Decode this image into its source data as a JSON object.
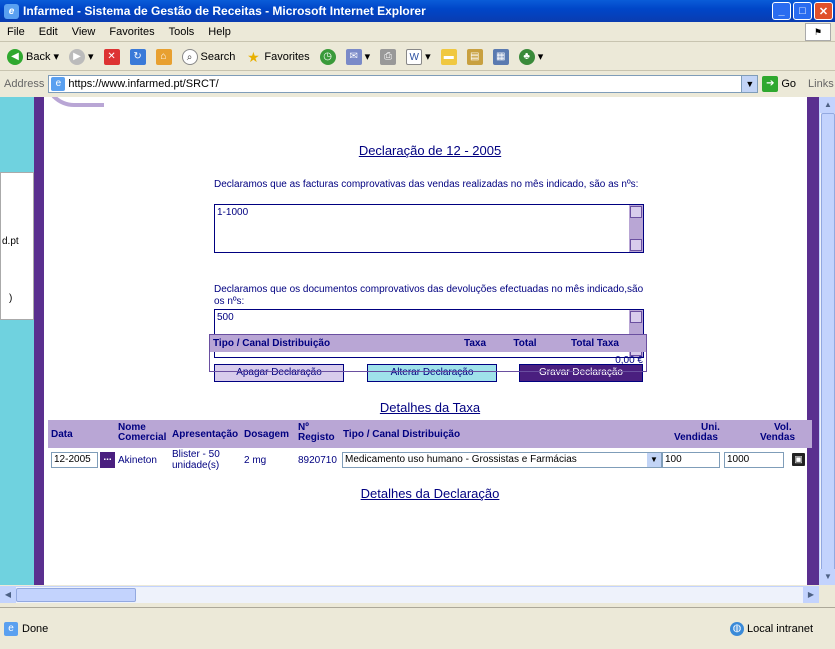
{
  "window": {
    "title": "Infarmed - Sistema de Gestão de Receitas - Microsoft Internet Explorer"
  },
  "menu": [
    "File",
    "Edit",
    "View",
    "Favorites",
    "Tools",
    "Help"
  ],
  "toolbar": {
    "back": "Back",
    "search": "Search",
    "favorites": "Favorites"
  },
  "address": {
    "label": "Address",
    "url": "https://www.infarmed.pt/SRCT/",
    "go": "Go",
    "links": "Links"
  },
  "left": {
    "fragment1": "d.pt",
    "fragment2": ")"
  },
  "page": {
    "title": "Declaração de 12 - 2005",
    "facturas_text": "Declaramos que as facturas comprovativas das vendas realizadas no mês indicado, são as nºs:",
    "facturas_value": "1-1000",
    "devolucoes_text": "Declaramos que os documentos comprovativos das devoluções efectuadas no mês indicado,são os nºs:",
    "devolucoes_value": "500",
    "btn_apagar": "Apagar Declaração",
    "btn_alterar": "Alterar Declaração",
    "btn_gravar": "Gravar Declaração",
    "taxa_heading": "Detalhes da Taxa",
    "taxa_cols": {
      "tipo": "Tipo / Canal Distribuição",
      "taxa": "Taxa",
      "total": "Total",
      "total_taxa": "Total Taxa"
    },
    "taxa_value": "0,00 €",
    "decl_heading": "Detalhes da Declaração",
    "decl_cols": {
      "data": "Data",
      "nome_1": "Nome",
      "nome_2": "Comercial",
      "apresentacao": "Apresentação",
      "dosagem": "Dosagem",
      "registo_1": "Nº",
      "registo_2": "Registo",
      "tipo": "Tipo / Canal Distribuição",
      "uni_1": "Uni.",
      "uni_2": "Vendidas",
      "vol_1": "Vol.",
      "vol_2": "Vendas"
    },
    "row": {
      "data": "12-2005",
      "ellipsis": "...",
      "nome": "Akineton",
      "apresentacao": "Blister - 50 unidade(s)",
      "dosagem": "2 mg",
      "registo": "8920710",
      "tipo": "Medicamento uso humano - Grossistas e Farmácias",
      "uni": "100",
      "vol": "1000"
    }
  },
  "status": {
    "done": "Done",
    "zone": "Local intranet"
  }
}
